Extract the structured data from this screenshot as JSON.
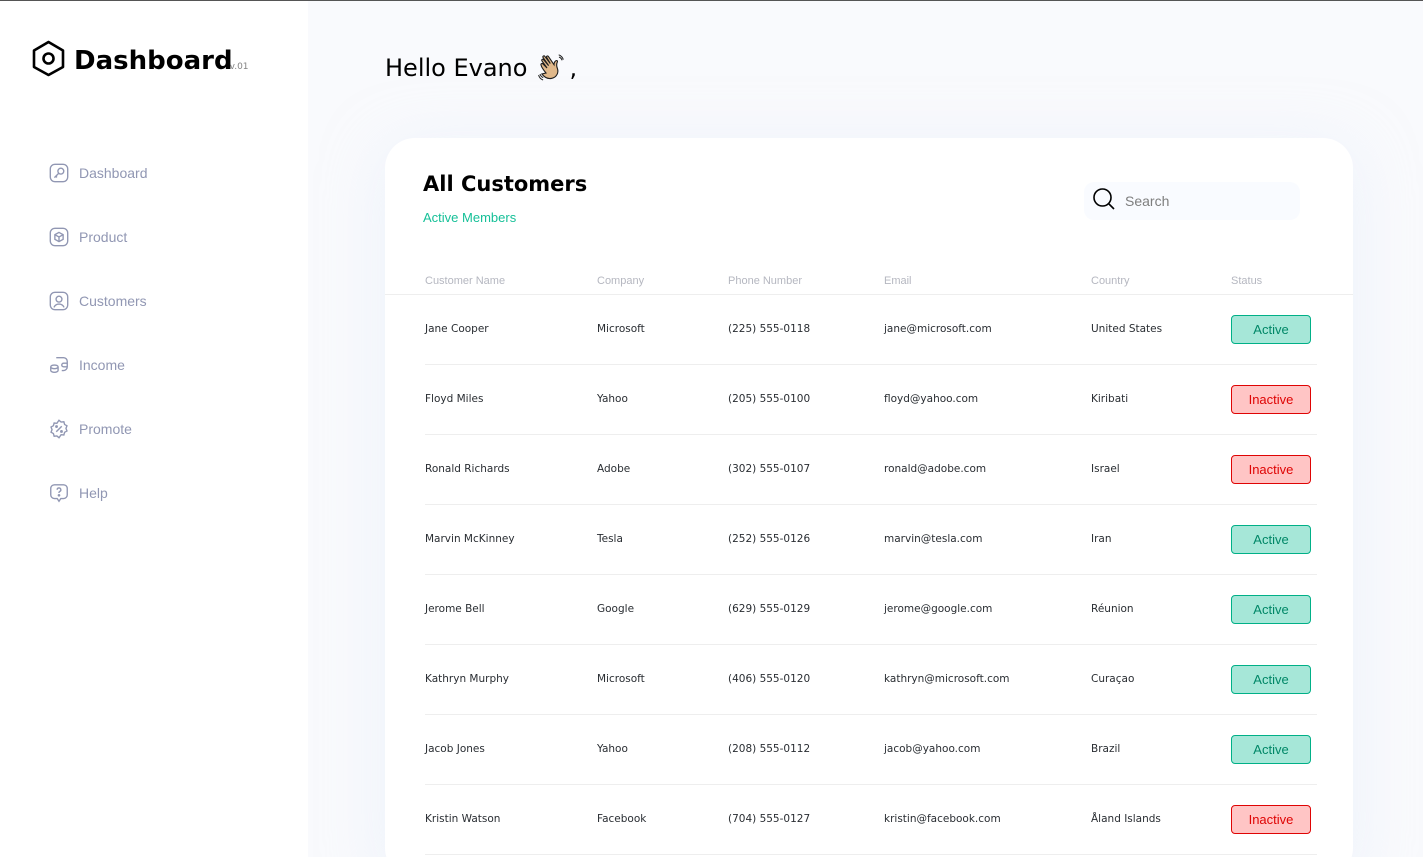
{
  "app": {
    "logo_text": "Dashboard",
    "logo_version": "v.01"
  },
  "sidebar": {
    "items": [
      {
        "label": "Dashboard",
        "icon": "key-square-icon"
      },
      {
        "label": "Product",
        "icon": "cube-icon"
      },
      {
        "label": "Customers",
        "icon": "user-square-icon"
      },
      {
        "label": "Income",
        "icon": "wallet-money-icon"
      },
      {
        "label": "Promote",
        "icon": "discount-shape-icon"
      },
      {
        "label": "Help",
        "icon": "message-question-icon"
      }
    ]
  },
  "header": {
    "greeting": "Hello Evano",
    "greeting_suffix": ","
  },
  "customers": {
    "title": "All Customers",
    "subtitle": "Active Members",
    "search": {
      "placeholder": "Search"
    },
    "columns": [
      "Customer Name",
      "Company",
      "Phone Number",
      "Email",
      "Country",
      "Status"
    ],
    "rows": [
      {
        "name": "Jane Cooper",
        "company": "Microsoft",
        "phone": "(225) 555-0118",
        "email": "jane@microsoft.com",
        "country": "United States",
        "status": "Active"
      },
      {
        "name": "Floyd Miles",
        "company": "Yahoo",
        "phone": "(205) 555-0100",
        "email": "floyd@yahoo.com",
        "country": "Kiribati",
        "status": "Inactive"
      },
      {
        "name": "Ronald Richards",
        "company": "Adobe",
        "phone": "(302) 555-0107",
        "email": "ronald@adobe.com",
        "country": "Israel",
        "status": "Inactive"
      },
      {
        "name": "Marvin McKinney",
        "company": "Tesla",
        "phone": "(252) 555-0126",
        "email": "marvin@tesla.com",
        "country": "Iran",
        "status": "Active"
      },
      {
        "name": "Jerome Bell",
        "company": "Google",
        "phone": "(629) 555-0129",
        "email": "jerome@google.com",
        "country": "Réunion",
        "status": "Active"
      },
      {
        "name": "Kathryn Murphy",
        "company": "Microsoft",
        "phone": "(406) 555-0120",
        "email": "kathryn@microsoft.com",
        "country": "Curaçao",
        "status": "Active"
      },
      {
        "name": "Jacob Jones",
        "company": "Yahoo",
        "phone": "(208) 555-0112",
        "email": "jacob@yahoo.com",
        "country": "Brazil",
        "status": "Active"
      },
      {
        "name": "Kristin Watson",
        "company": "Facebook",
        "phone": "(704) 555-0127",
        "email": "kristin@facebook.com",
        "country": "Åland Islands",
        "status": "Inactive"
      }
    ]
  },
  "colors": {
    "accent_green": "#16c098",
    "active_bg": "#a6e7d8",
    "active_text": "#008767",
    "inactive_bg": "#ffc5c5",
    "inactive_text": "#df0404",
    "nav_text": "#9197b3"
  }
}
